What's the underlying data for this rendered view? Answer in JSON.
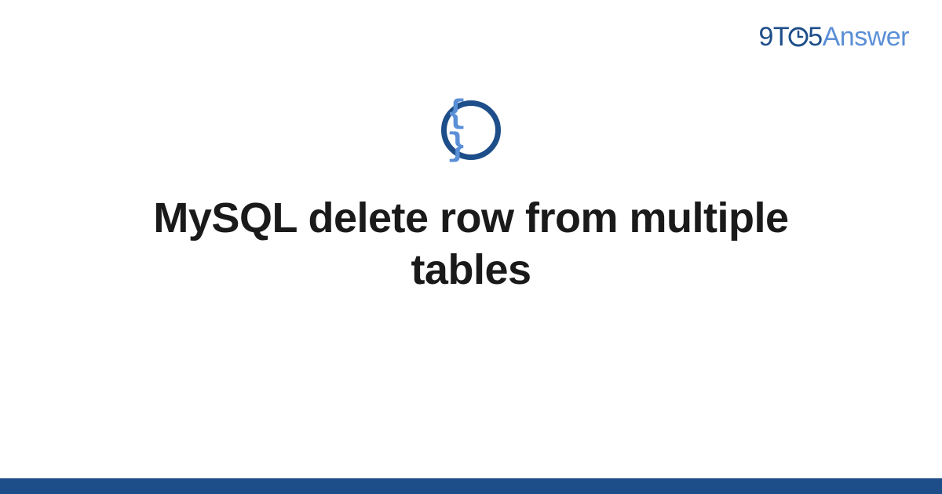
{
  "brand": {
    "nine": "9",
    "t": "T",
    "five": "5",
    "answer": "Answer"
  },
  "icon": {
    "braces": "{ }"
  },
  "main": {
    "title": "MySQL delete row from multiple tables"
  },
  "colors": {
    "primary": "#1d4e89",
    "accent": "#5a8fd6",
    "text": "#1a1a1a"
  }
}
